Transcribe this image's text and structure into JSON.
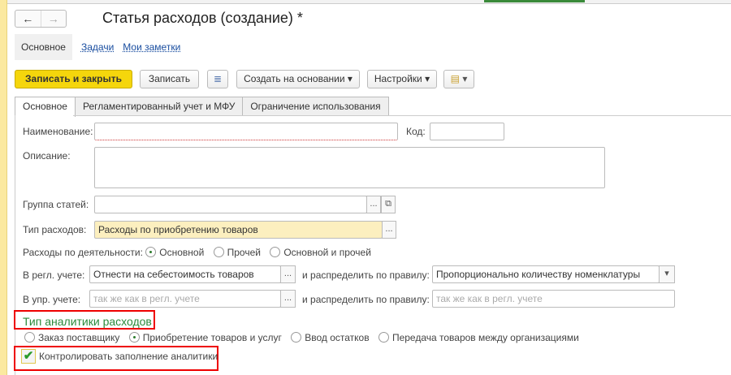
{
  "window": {
    "title": "Статья расходов (создание) *"
  },
  "nav_tabs": {
    "main": "Основное",
    "tasks": "Задачи",
    "notes": "Мои заметки"
  },
  "toolbar": {
    "save_close": "Записать и закрыть",
    "save": "Записать",
    "create_based": "Создать на основании",
    "settings": "Настройки"
  },
  "tabs": [
    "Основное",
    "Регламентированный учет и МФУ",
    "Ограничение использования"
  ],
  "form": {
    "name_label": "Наименование:",
    "name_value": "",
    "code_label": "Код:",
    "code_value": "",
    "description_label": "Описание:",
    "description_value": "",
    "group_label": "Группа статей:",
    "group_value": "",
    "type_label": "Тип расходов:",
    "type_value": "Расходы по приобретению товаров",
    "activity_label": "Расходы по деятельности:",
    "activity_options": [
      "Основной",
      "Прочей",
      "Основной и прочей"
    ],
    "activity_selected": 0,
    "regl_label": "В регл. учете:",
    "regl_value": "Отнести на себестоимость товаров",
    "distribute_label": "и распределить по правилу:",
    "regl_rule_value": "Пропорционально количеству номенклатуры",
    "upr_label": "В упр. учете:",
    "upr_placeholder": "так же как в регл. учете",
    "upr_rule_placeholder": "так же как в регл. учете",
    "analytics_title": "Тип аналитики расходов",
    "analytics_options": [
      "Заказ поставщику",
      "Приобретение товаров и услуг",
      "Ввод остатков",
      "Передача товаров между организациями"
    ],
    "analytics_selected": 1,
    "control_label": "Контролировать заполнение аналитики",
    "control_checked": true
  }
}
